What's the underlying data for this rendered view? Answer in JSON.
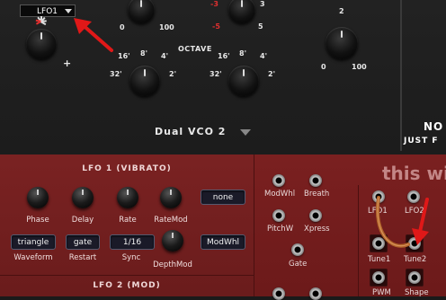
{
  "top": {
    "lfo1_tag": "LFO1",
    "vco_title": "Dual VCO 2",
    "octave_label": "OCTAVE",
    "pm_plus": "+",
    "knob_a_scale": {
      "min": "0",
      "max": "100"
    },
    "knob_b_scale": {
      "minus3": "-3",
      "minus5": "-5",
      "plus3": "3",
      "plus5": "5"
    },
    "knob_c_scale": {
      "min": "0",
      "max": "100",
      "top": "2"
    },
    "octave_a": [
      "32'",
      "16'",
      "8'",
      "4'",
      "2'"
    ],
    "octave_b": [
      "32'",
      "16'",
      "8'",
      "4'",
      "2'"
    ],
    "right_title_1": "NO",
    "right_title_2": "JUST F"
  },
  "lfo1": {
    "title": "LFO 1 (VIBRATO)",
    "knobs": [
      "Phase",
      "Delay",
      "Rate",
      "RateMod"
    ],
    "waveform_value": "triangle",
    "waveform_label": "Waveform",
    "restart_value": "gate",
    "restart_label": "Restart",
    "sync_value": "1/16",
    "sync_label": "Sync",
    "depthmod_label": "DepthMod",
    "ratemod_source": "none",
    "depthmod_source": "ModWhl"
  },
  "lfo2": {
    "title": "LFO 2 (MOD)"
  },
  "mod": {
    "title_partial": "this wi",
    "jacks": [
      "ModWhl",
      "Breath",
      "PitchW",
      "Xpress",
      "Gate"
    ],
    "outputs": [
      "LFO1",
      "LFO2",
      "Tune1",
      "Tune2",
      "PWM",
      "Shape"
    ]
  },
  "colors": {
    "accent_red": "#e02020",
    "panel_red": "#6a1c1c",
    "cable": "#b0642a"
  }
}
